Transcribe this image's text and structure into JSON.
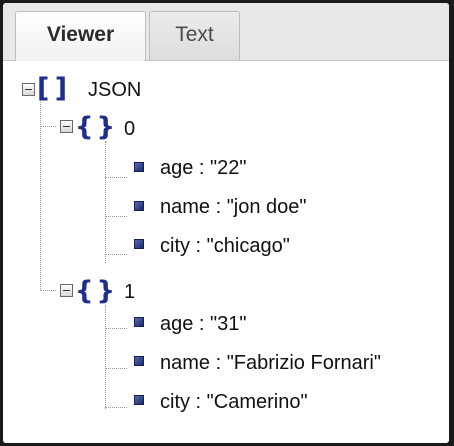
{
  "tabs": {
    "viewer_label": "Viewer",
    "text_label": "Text"
  },
  "tree": {
    "root": {
      "brackets": "[ ]",
      "label": "JSON"
    },
    "items": [
      {
        "braces": "{ }",
        "index": "0",
        "fields": [
          {
            "text": "age : \"22\""
          },
          {
            "text": "name : \"jon doe\""
          },
          {
            "text": "city : \"chicago\""
          }
        ]
      },
      {
        "braces": "{ }",
        "index": "1",
        "fields": [
          {
            "text": "age : \"31\""
          },
          {
            "text": "name : \"Fabrizio Fornari\""
          },
          {
            "text": "city : \"Camerino\""
          }
        ]
      }
    ]
  },
  "icons": {
    "collapse": "minus-box-icon",
    "array": "array-brackets-icon",
    "object": "object-braces-icon",
    "value": "square-value-icon"
  },
  "colors": {
    "icon_blue": "#1f2e8c",
    "tab_bar": "#e8e8e8",
    "text": "#111111"
  }
}
